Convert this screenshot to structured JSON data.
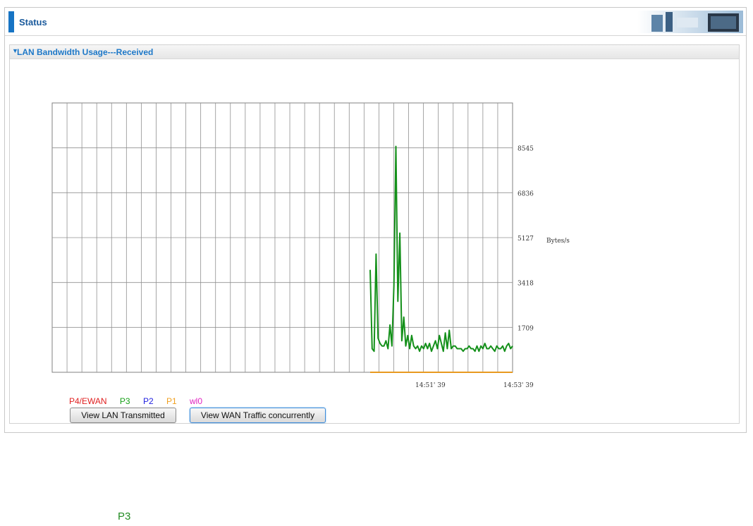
{
  "header": {
    "title": "Status"
  },
  "section": {
    "title": "LAN Bandwidth Usage---Received"
  },
  "legend": [
    {
      "label": "P4/EWAN",
      "color": "#e02020"
    },
    {
      "label": "P3",
      "color": "#18a018"
    },
    {
      "label": "P2",
      "color": "#2020e0"
    },
    {
      "label": "P1",
      "color": "#f0a020"
    },
    {
      "label": "wl0",
      "color": "#e020c0"
    }
  ],
  "buttons": {
    "view_lan_transmitted": "View LAN Transmitted",
    "view_wan_traffic": "View WAN Traffic concurrently"
  },
  "bottom_label": "P3",
  "chart_data": {
    "type": "line",
    "title": "",
    "ylabel": "Bytes/s",
    "y_ticks": [
      "1709",
      "3418",
      "5127",
      "6836",
      "8545"
    ],
    "ylim": [
      0,
      10254
    ],
    "x_tick_labels": [
      "14:51' 39",
      "14:53' 39"
    ],
    "grid": true,
    "series": [
      {
        "name": "P3",
        "color": "#14901a",
        "values": [
          3900,
          900,
          800,
          4500,
          1300,
          1100,
          1000,
          1000,
          1200,
          900,
          1800,
          1000,
          3300,
          8600,
          2700,
          5300,
          1200,
          2100,
          1000,
          1400,
          900,
          1400,
          1000,
          900,
          1000,
          800,
          1000,
          900,
          1100,
          900,
          1100,
          800,
          1000,
          1200,
          900,
          1400,
          1100,
          800,
          1500,
          900,
          1600,
          900,
          1000,
          1000,
          900,
          900,
          900,
          800,
          900,
          900,
          1000,
          900,
          900,
          800,
          1000,
          800,
          1000,
          900,
          1100,
          900,
          900,
          1000,
          900,
          800,
          1000,
          900,
          900,
          1000,
          800,
          1000,
          1100,
          900,
          1000
        ]
      },
      {
        "name": "P1",
        "color": "#e89a20",
        "values": [
          0,
          0,
          0,
          0,
          0,
          0,
          0,
          0,
          0,
          0,
          0,
          0,
          0,
          0,
          0,
          0,
          0,
          0,
          0,
          0,
          0,
          0,
          0,
          0,
          0,
          0,
          0,
          0,
          0,
          0,
          0,
          0,
          0,
          0,
          0,
          0,
          0,
          0,
          0,
          0,
          0,
          0,
          0,
          0,
          0,
          0,
          0,
          0,
          0,
          0,
          0,
          0,
          0,
          0,
          0,
          0,
          0,
          0,
          0,
          0,
          0,
          0,
          0,
          0,
          0,
          0,
          0,
          0,
          0,
          0,
          0,
          0,
          0
        ]
      }
    ]
  }
}
